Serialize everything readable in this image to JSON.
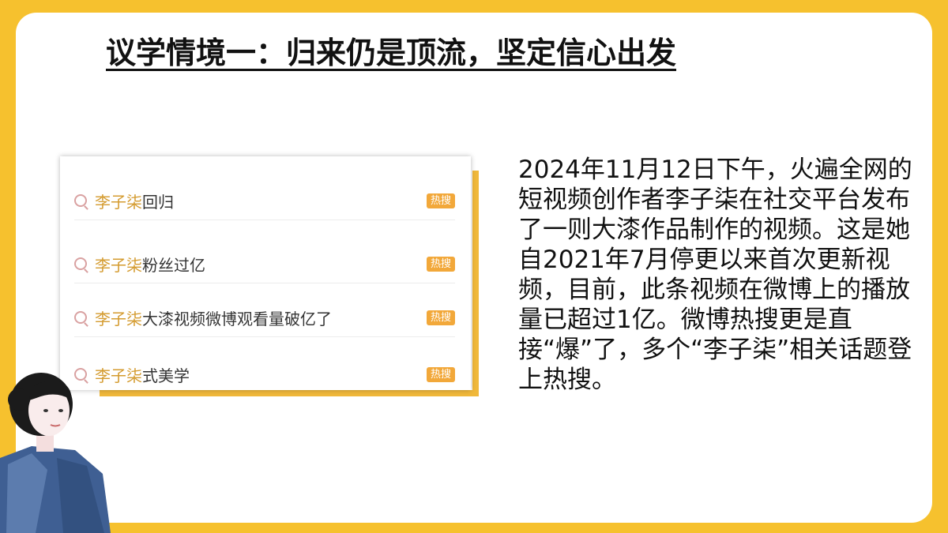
{
  "slide": {
    "title": "议学情境一：归来仍是顶流，坚定信心出发",
    "paragraph": "2024年11月12日下午，火遍全网的短视频创作者李子柒在社交平台发布了一则大漆作品制作的视频。这是她自2021年7月停更以来首次更新视频，目前，此条视频在微博上的播放量已超过1亿。微博热搜更是直接“爆”了，多个“李子柒”相关话题登上热搜。"
  },
  "hot_search": {
    "badge_label": "热搜",
    "icon": "search-icon",
    "items": [
      {
        "name": "李子柒",
        "rest": "回归"
      },
      {
        "name": "李子柒",
        "rest": "粉丝过亿"
      },
      {
        "name": "李子柒",
        "rest": "大漆视频微博观看量破亿了"
      },
      {
        "name": "李子柒",
        "rest": "式美学"
      }
    ]
  },
  "colors": {
    "frame": "#f6c12e",
    "accent": "#f0b83b",
    "highlight_name": "#d49b2f",
    "badge": "#f2a83a"
  }
}
